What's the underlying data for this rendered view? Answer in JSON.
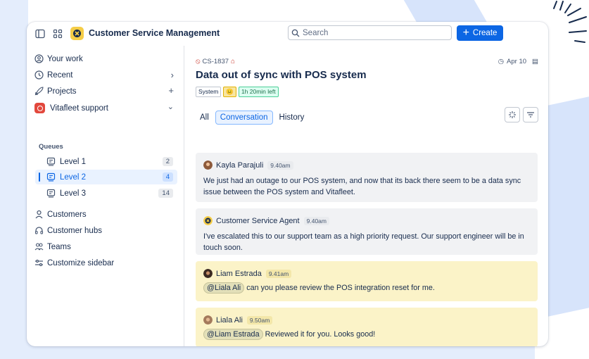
{
  "app": {
    "name": "Customer Service Management",
    "search_placeholder": "Search",
    "create_label": "Create"
  },
  "sidebar": {
    "your_work": "Your work",
    "recent": "Recent",
    "projects": "Projects",
    "project_name": "Vitafleet support",
    "queues_label": "Queues",
    "levels": [
      {
        "label": "Level 1",
        "count": "2"
      },
      {
        "label": "Level 2",
        "count": "4"
      },
      {
        "label": "Level 3",
        "count": "14"
      }
    ],
    "customers": "Customers",
    "customer_hubs": "Customer hubs",
    "teams": "Teams",
    "customize": "Customize sidebar"
  },
  "ticket": {
    "id": "CS-1837",
    "date": "Apr 10",
    "title": "Data out of sync with POS system",
    "tags": {
      "system": "System",
      "emoji": "😐",
      "time": "1h 20min left"
    }
  },
  "tabs": [
    "All",
    "Conversation",
    "History"
  ],
  "messages": [
    {
      "author": "Kayla Parajuli",
      "time": "9.40am",
      "body": "We just had an outage to our POS system, and now that its back there seem to be a data sync issue between the POS system and Vitafleet."
    },
    {
      "author": "Customer Service Agent",
      "time": "9.40am",
      "body": "I've escalated this to our support team as a high priority request. Our support engineer will be in touch soon."
    },
    {
      "author": "Liam Estrada",
      "time": "9.41am",
      "mention": "@Liala Ali",
      "body": "can you please review the POS integration reset for me."
    },
    {
      "author": "Liala Ali",
      "time": "9.50am",
      "mention": "@Liam Estrada",
      "body": "Reviewed it for you. Looks good!"
    }
  ],
  "colors": {
    "brand_yellow": "#f5cd47",
    "primary_blue": "#0c66e4",
    "project_red": "#e2483d",
    "highlight_yellow": "#fbf3c8"
  }
}
